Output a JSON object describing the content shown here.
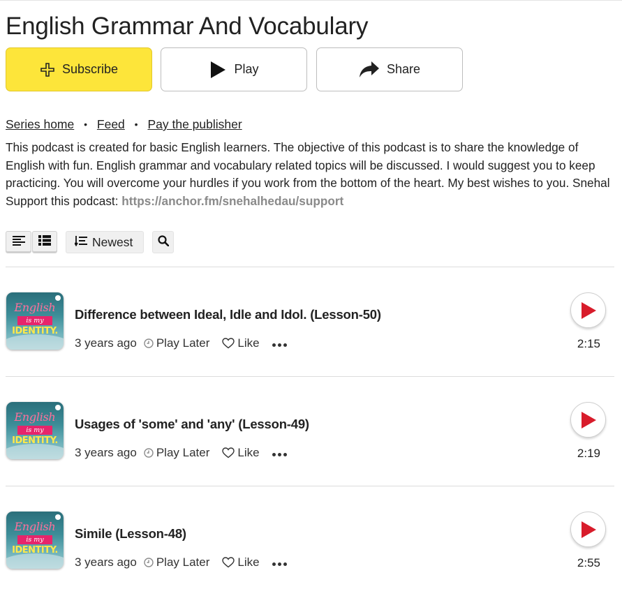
{
  "podcast": {
    "title": "English Grammar And Vocabulary",
    "actions": {
      "subscribe": "Subscribe",
      "play": "Play",
      "share": "Share"
    },
    "links": {
      "series_home": "Series home",
      "feed": "Feed",
      "pay": "Pay the publisher",
      "separator": "•"
    },
    "description": "This podcast is created for basic English learners. The objective of this podcast is to share the knowledge of English with fun. English grammar and vocabulary related topics will be discussed. I would suggest you to keep practicing. You will overcome your hurdles if you work from the bottom of the heart. My best wishes to you. Snehal Support this podcast: ",
    "support_url": "https://anchor.fm/snehalhedau/support"
  },
  "toolbar": {
    "sort_label": "Newest"
  },
  "artwork": {
    "line1": "English",
    "line2": "is my",
    "line3": "IDENTITY."
  },
  "episodes": [
    {
      "title": "Difference between Ideal, Idle and Idol. (Lesson-50)",
      "age": "3 years ago",
      "play_later": "Play Later",
      "like": "Like",
      "duration": "2:15"
    },
    {
      "title": "Usages of 'some' and 'any' (Lesson-49)",
      "age": "3 years ago",
      "play_later": "Play Later",
      "like": "Like",
      "duration": "2:19"
    },
    {
      "title": "Simile (Lesson-48)",
      "age": "3 years ago",
      "play_later": "Play Later",
      "like": "Like",
      "duration": "2:55"
    }
  ],
  "colors": {
    "subscribe_bg": "#fde53a",
    "play_accent": "#d81c2b",
    "link_gray": "#8a8a8a"
  },
  "icons": [
    "plus-icon",
    "play-icon",
    "share-arrow-icon",
    "list-compact-icon",
    "list-detail-icon",
    "sort-icon",
    "search-icon",
    "clock-icon",
    "heart-icon",
    "more-dots-icon"
  ]
}
